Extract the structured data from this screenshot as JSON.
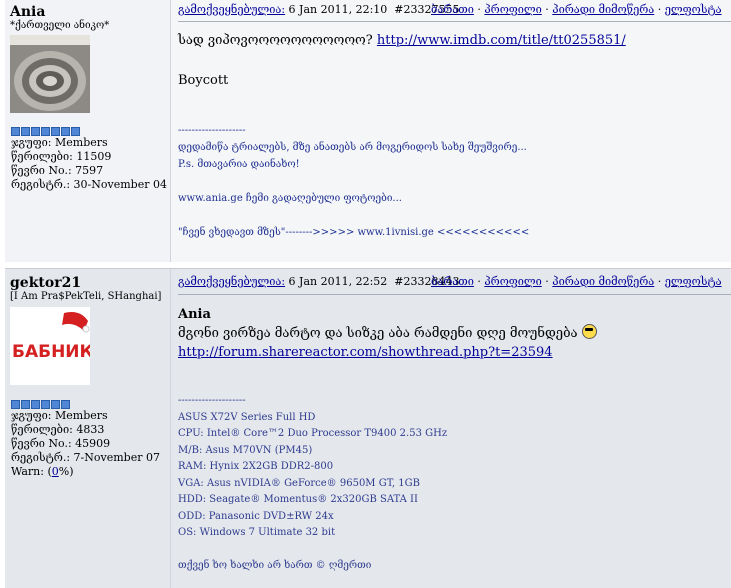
{
  "posts": [
    {
      "author": "Ania",
      "user_title": "*ქართველი ანიკო*",
      "rank_stars": 7,
      "stats": {
        "group": "ჯგუფი: Members",
        "posts": "წერილები: 11509",
        "member_no": "წევრი No.: 7597",
        "registered": "რეგისტრ.: 30-November 04"
      },
      "header": {
        "posted_label": "გამოქვეყნებულია:",
        "date": "6 Jan 2011, 22:10",
        "post_id": "#23327555",
        "actions": [
          "ბარათი",
          "პროფილი",
          "პირადი მიმოწერა",
          "ელფოსტა"
        ]
      },
      "body": {
        "line1": "სად ვიპოვოოოოოოოოოოო? ",
        "link": "http://www.imdb.com/title/tt0255851/",
        "line2": "Boycott"
      },
      "signature": [
        "--------------------",
        "დედამიწა ტრიალებს, მზე ანათებს არ მოგერიდოს სახე შეუშვირე...",
        "P.s. მთავარია დაინახო!",
        "",
        "www.ania.ge ჩემი გადაღებული ფოტოები...",
        "",
        "\"ჩვენ ვხედავთ მზეს\"-------->>>>> www.1ivnisi.ge <<<<<<<<<<<"
      ]
    },
    {
      "author": "gektor21",
      "user_title": "[I Am Pra$PekTeli, SHanghai]",
      "avatar_text": "БАБНИК",
      "rank_stars": 6,
      "stats": {
        "group": "ჯგუფი: Members",
        "posts": "წერილები: 4833",
        "member_no": "წევრი No.: 45909",
        "registered": "რეგისტრ.: 7-November 07",
        "warn_label": "Warn: (",
        "warn_value": "0",
        "warn_suffix": "%)"
      },
      "header": {
        "posted_label": "გამოქვეყნებულია:",
        "date": "6 Jan 2011, 22:52",
        "post_id": "#23328443",
        "actions": [
          "ბარათი",
          "პროფილი",
          "პირადი მიმოწერა",
          "ელფოსტა"
        ]
      },
      "body": {
        "quote_name": "Ania",
        "line1": "მგონი ვირზეა მარტო და სიზკე აბა რამდენი დღე მოუნდება ",
        "link": "http://forum.sharereactor.com/showthread.php?t=23594"
      },
      "signature": [
        "--------------------",
        "ASUS X72V Series Full HD",
        "CPU: Intel® Core™2 Duo Processor T9400 2.53 GHz",
        "M/B: Asus M70VN (PM45)",
        "RAM: Hynix 2X2GB DDR2-800",
        "VGA: Asus nVIDIA® GeForce® 9650M GT, 1GB",
        "HDD: Seagate® Momentus® 2x320GB SATA II",
        "ODD: Panasonic DVD±RW 24x",
        "OS: Windows 7 Ultimate 32 bit",
        "",
        "თქვენ ხო ხალხი არ ხართ © ღმერთი"
      ]
    }
  ],
  "colors": {
    "link": "#000099",
    "signature": "#1c2e8f",
    "star": "#4f86d6"
  }
}
